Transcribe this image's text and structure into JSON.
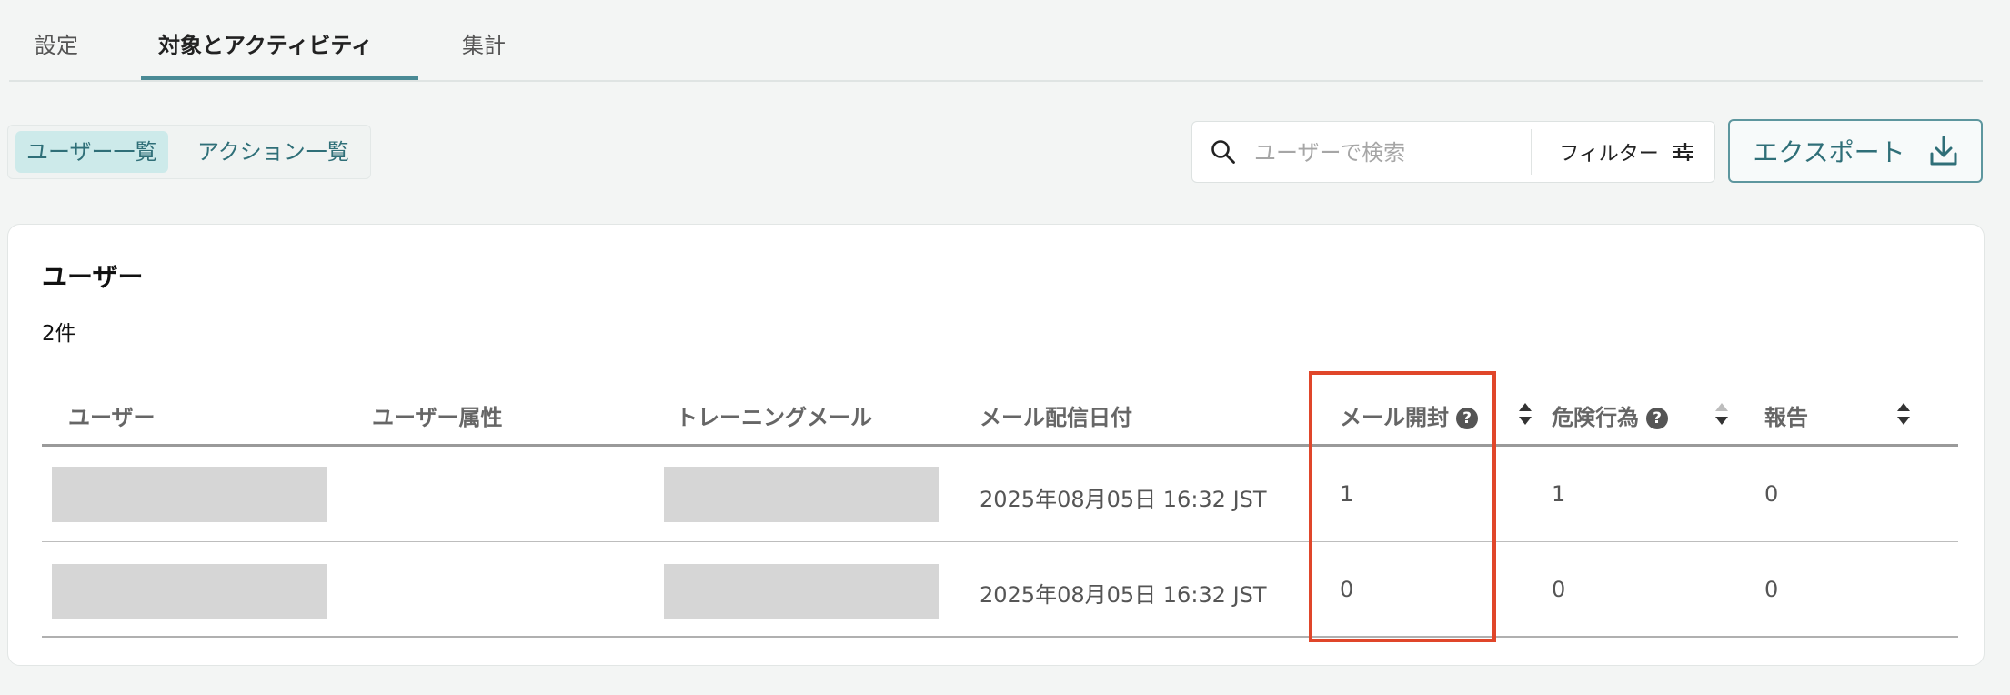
{
  "tabs": [
    {
      "label": "設定"
    },
    {
      "label": "対象とアクティビティ"
    },
    {
      "label": "集計"
    }
  ],
  "view_toggle": {
    "users": "ユーザー一覧",
    "actions": "アクション一覧"
  },
  "search": {
    "placeholder": "ユーザーで検索"
  },
  "filter": {
    "label": "フィルター"
  },
  "export": {
    "label": "エクスポート"
  },
  "users_card": {
    "title": "ユーザー",
    "count": "2件",
    "columns": {
      "user": "ユーザー",
      "attributes": "ユーザー属性",
      "training_mail": "トレーニングメール",
      "sent_date": "メール配信日付",
      "mail_opened": "メール開封",
      "risky_action": "危険行為",
      "reported": "報告"
    },
    "help_glyph": "?",
    "rows": [
      {
        "sent_date": "2025年08月05日 16:32 JST",
        "mail_opened": "1",
        "risky_action": "1",
        "reported": "0"
      },
      {
        "sent_date": "2025年08月05日 16:32 JST",
        "mail_opened": "0",
        "risky_action": "0",
        "reported": "0"
      }
    ]
  },
  "colors": {
    "accent": "#4a8a95",
    "highlight_box": "#e0462a",
    "redacted": "#d6d6d6"
  }
}
